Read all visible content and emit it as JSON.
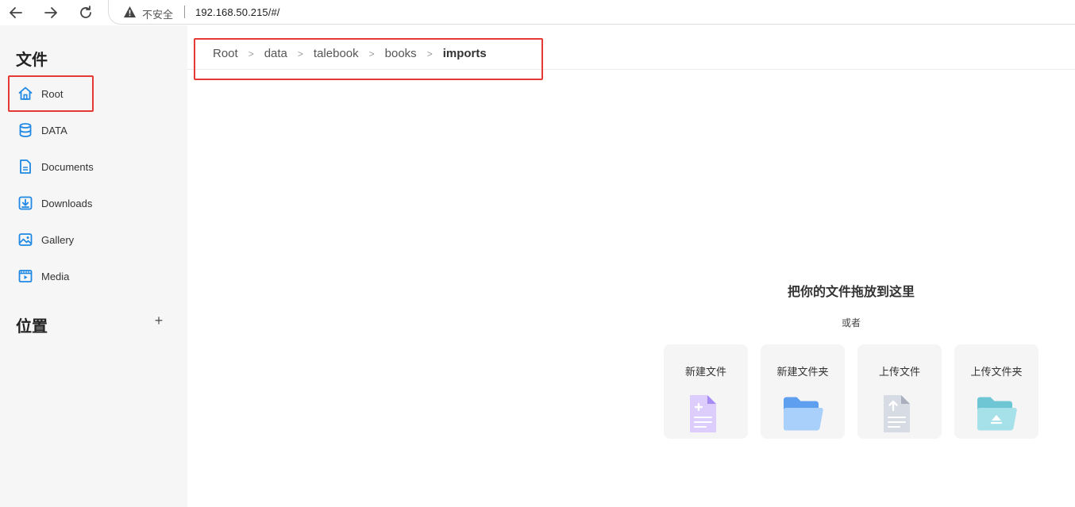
{
  "browser": {
    "security_label": "不安全",
    "url": "192.168.50.215/#/"
  },
  "sidebar": {
    "files_title": "文件",
    "places_title": "位置",
    "add_place_label": "+",
    "items": [
      {
        "label": "Root",
        "icon": "home-icon"
      },
      {
        "label": "DATA",
        "icon": "database-icon"
      },
      {
        "label": "Documents",
        "icon": "document-icon"
      },
      {
        "label": "Downloads",
        "icon": "download-icon"
      },
      {
        "label": "Gallery",
        "icon": "image-icon"
      },
      {
        "label": "Media",
        "icon": "video-icon"
      }
    ]
  },
  "breadcrumb": {
    "items": [
      "Root",
      "data",
      "talebook",
      "books"
    ],
    "current": "imports",
    "separator": ">"
  },
  "dropzone": {
    "title": "把你的文件拖放到这里",
    "or": "或者",
    "actions": [
      {
        "label": "新建文件",
        "icon": "new-file-icon"
      },
      {
        "label": "新建文件夹",
        "icon": "new-folder-icon"
      },
      {
        "label": "上传文件",
        "icon": "upload-file-icon"
      },
      {
        "label": "上传文件夹",
        "icon": "upload-folder-icon"
      }
    ]
  },
  "colors": {
    "accent": "#1e88e5",
    "highlight": "#e53935",
    "sidebar_bg": "#f6f6f6"
  }
}
